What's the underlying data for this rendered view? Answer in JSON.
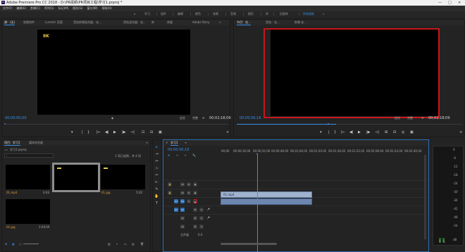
{
  "window": {
    "title": "Adobe Premiere Pro CC 2018 - D:\\PR视频\\PR项目工程\\学习1.prproj *",
    "app_icon": "Pr",
    "controls": [
      "—",
      "□",
      "✕"
    ]
  },
  "menu": {
    "items": [
      "文件(F)",
      "编辑(E)",
      "剪辑(C)",
      "序列(S)",
      "标记(M)",
      "图形(G)",
      "窗口(W)",
      "帮助(H)"
    ]
  },
  "workspaces": {
    "home_icon": "⌂",
    "items": [
      "学习",
      "组件",
      "编辑",
      "颜色",
      "效果",
      "音频",
      "图形",
      "库",
      "旧版库",
      "所有面板"
    ],
    "active_index": 8,
    "overflow": "»"
  },
  "source_panel": {
    "tabs": [
      "源：(无)",
      "效果控件",
      "Lumetri 范围",
      "音轨剪辑混合器：化...",
      "音轨混合器：化...",
      "库",
      "库窗",
      "Adobe Story"
    ],
    "menu_icon": "≡",
    "video_text": "8K",
    "timecode_left": "00;00;00;00",
    "timecode_right": "00;02;18;09",
    "fit": "适合",
    "resolution": "完整",
    "expand": "»"
  },
  "program_panel": {
    "tabs": [
      "节目：化...",
      "音轨：化...",
      "剪辑 化..."
    ],
    "timecode_left": "00;00;56;16",
    "fit": "适合",
    "resolution": "完整",
    "timecode_right": "00;02;18;09"
  },
  "transport_source": [
    "▾",
    "|",
    "{",
    "}",
    "|←",
    "◀|",
    "▶",
    "|▶",
    "→|",
    "⊡",
    "⊟",
    "▣",
    "+"
  ],
  "transport_program": [
    "▾",
    "|",
    "{",
    "}",
    "|←",
    "◀|",
    "▶",
    "|▶",
    "→|",
    "⊞",
    "⊟",
    "◎",
    "▣",
    "+"
  ],
  "project_panel": {
    "tabs": [
      "项目：学习1",
      "媒体浏览器"
    ],
    "menu_icon": "≡",
    "project_name": "学习1.prproj",
    "search_placeholder": "",
    "selection_info": "1 项已选择，共 4 项",
    "items": [
      {
        "name": "01.mp4",
        "duration": "6;06"
      },
      {
        "name": "",
        "duration": ""
      },
      {
        "name": "01.jpg",
        "duration": "5;00"
      },
      {
        "name": "01.jpg",
        "duration": "2;09;09"
      }
    ]
  },
  "tools": [
    "▸",
    "⇥",
    "↔",
    "◇",
    "✂",
    "⇤",
    "✎",
    "✋",
    "T"
  ],
  "timeline": {
    "tab": "学习1",
    "close": "✕",
    "menu_icon": "≡",
    "timecode": "00;00;56;16",
    "ruler": [
      "00;00",
      "00;00;16;00",
      "00;00;32;00",
      "00;00;48;00",
      "00;01;04;02",
      "00;01;20;02",
      "00;01;36;02",
      "00;01;52;02",
      "00;02;08;04",
      "00;02;24;04",
      "00;02;40;04"
    ],
    "tracks": [
      {
        "label": "V3"
      },
      {
        "label": "V2"
      },
      {
        "label": "V1"
      },
      {
        "label": "A1"
      },
      {
        "label": "A2"
      },
      {
        "label": "A3"
      }
    ],
    "master_label": "主声道",
    "master_value": "0.0",
    "video_clip_label": "01.mp4"
  },
  "meters": {
    "scale": [
      "0",
      "-6",
      "-12",
      "-18",
      "-24",
      "-30",
      "-36",
      "-42",
      "-48",
      "-54",
      "dB"
    ],
    "footer": [
      "S",
      "S"
    ]
  }
}
